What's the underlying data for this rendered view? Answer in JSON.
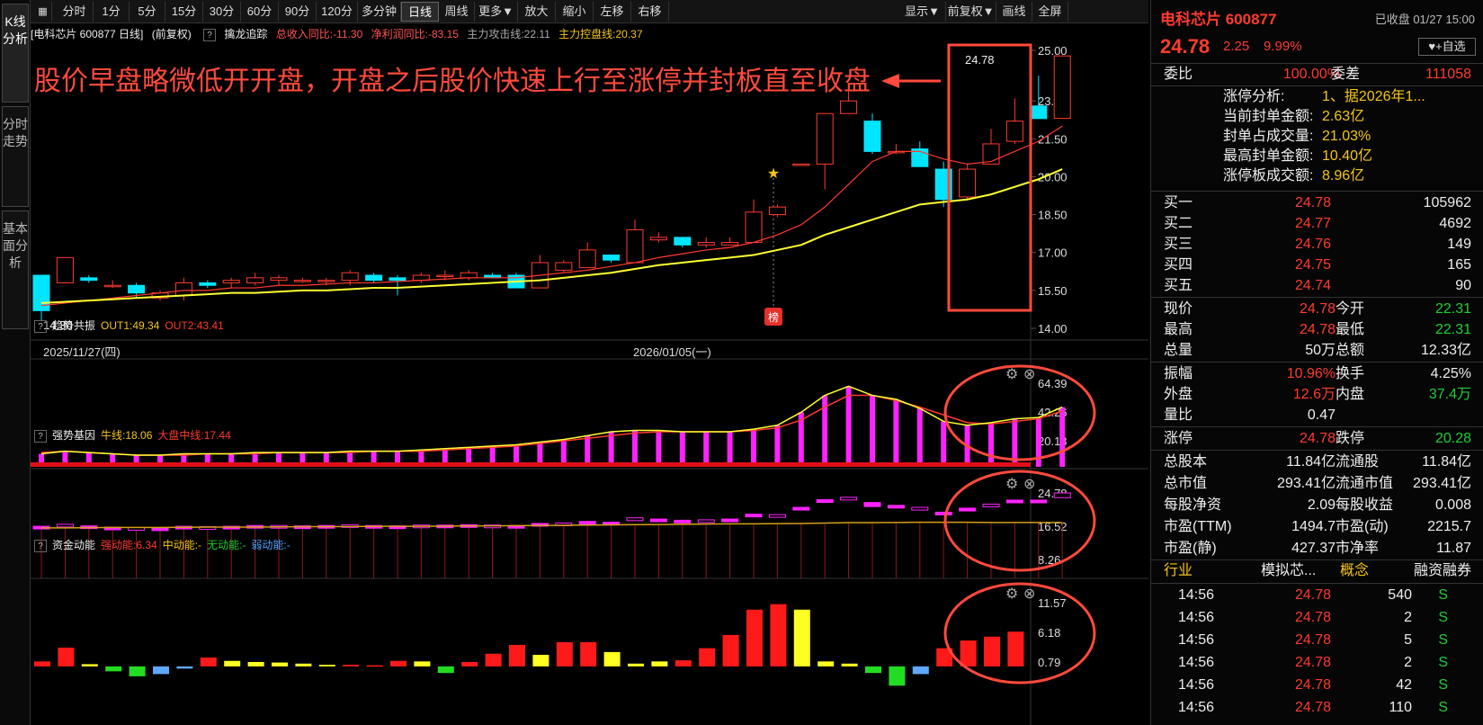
{
  "left_tabs": [
    "K线分析",
    "分时走势",
    "基本面分析"
  ],
  "toolbar": {
    "left": [
      "分时",
      "1分",
      "5分",
      "15分",
      "30分",
      "60分",
      "90分",
      "120分",
      "多分钟",
      "日线",
      "周线",
      "更多▼",
      "放大",
      "缩小",
      "左移",
      "右移"
    ],
    "active": "日线",
    "right": [
      "显示▼",
      "前复权▼",
      "画线",
      "全屏"
    ]
  },
  "info": {
    "title": "[电科芯片 600877 日线]",
    "fq": "(前复权)",
    "q": "?",
    "indicator": "擒龙追踪",
    "rev": "总收入同比:-11.30",
    "profit": "净利润同比:-83.15",
    "atk": "主力攻击线:22.11",
    "ctl": "主力控盘线:20.37"
  },
  "annotation": "股价早盘略微低开开盘，开盘之后股价快速上行至涨停并封板直至收盘",
  "labels": {
    "high": "24.78",
    "low": "14.30",
    "bang": "榜"
  },
  "date_labels": [
    "2025/11/27(四)",
    "2026/01/05(一)"
  ],
  "axis_main": [
    "25.00",
    "23.00",
    "21.50",
    "20.00",
    "18.50",
    "17.00",
    "15.50",
    "14.00"
  ],
  "panels": [
    {
      "name": "趋势共振",
      "vals": [
        "OUT1:49.34",
        "OUT2:43.41"
      ],
      "axis": [
        "64.39",
        "42.26",
        "20.13"
      ]
    },
    {
      "name": "强势基因",
      "vals": [
        "牛线:18.06",
        "大盘中线:17.44"
      ],
      "axis": [
        "24.78",
        "16.52",
        "8.26"
      ]
    },
    {
      "name": "资金动能",
      "vals": [
        "强动能:6.34",
        "中动能:-",
        "无动能:-",
        "弱动能:-"
      ],
      "axis": [
        "11.57",
        "6.18",
        "0.79"
      ]
    }
  ],
  "chart_data": {
    "type": "candlestick",
    "candles": [
      [
        16.1,
        14.7,
        16.1,
        14.3
      ],
      [
        15.8,
        16.8,
        16.8,
        15.8
      ],
      [
        16.0,
        15.9,
        16.1,
        15.8
      ],
      [
        15.7,
        15.7,
        15.9,
        15.6
      ],
      [
        15.7,
        15.4,
        15.8,
        15.2
      ],
      [
        15.2,
        15.4,
        15.5,
        15.1
      ],
      [
        15.3,
        15.8,
        16.0,
        15.1
      ],
      [
        15.8,
        15.7,
        15.9,
        15.6
      ],
      [
        15.8,
        15.9,
        16.0,
        15.6
      ],
      [
        15.8,
        16.0,
        16.2,
        15.7
      ],
      [
        15.9,
        16.0,
        16.1,
        15.7
      ],
      [
        15.9,
        15.9,
        16.0,
        15.8
      ],
      [
        15.9,
        15.9,
        16.0,
        15.7
      ],
      [
        15.9,
        16.2,
        16.3,
        15.7
      ],
      [
        16.1,
        15.9,
        16.2,
        15.8
      ],
      [
        16.0,
        15.9,
        16.1,
        15.3
      ],
      [
        15.9,
        16.1,
        16.2,
        15.8
      ],
      [
        16.1,
        16.1,
        16.3,
        15.9
      ],
      [
        16.0,
        16.2,
        16.3,
        15.9
      ],
      [
        16.1,
        16.0,
        16.2,
        16.0
      ],
      [
        16.1,
        15.6,
        16.2,
        15.6
      ],
      [
        15.6,
        16.6,
        16.9,
        15.6
      ],
      [
        16.3,
        16.6,
        16.7,
        16.2
      ],
      [
        16.4,
        17.1,
        17.4,
        16.4
      ],
      [
        16.9,
        16.7,
        16.9,
        16.6
      ],
      [
        16.6,
        17.9,
        18.3,
        16.6
      ],
      [
        17.5,
        17.6,
        17.8,
        17.4
      ],
      [
        17.6,
        17.3,
        17.6,
        17.2
      ],
      [
        17.3,
        17.4,
        17.6,
        17.2
      ],
      [
        17.3,
        17.4,
        17.6,
        17.3
      ],
      [
        17.4,
        18.6,
        19.1,
        17.4
      ],
      [
        18.5,
        18.8,
        18.9,
        18.4
      ],
      [
        20.5,
        20.5,
        20.5,
        20.5
      ],
      [
        20.5,
        22.5,
        22.5,
        19.5
      ],
      [
        22.5,
        23.0,
        23.5,
        22.5
      ],
      [
        22.2,
        21.0,
        22.5,
        20.9
      ],
      [
        21.0,
        21.0,
        21.3,
        20.9
      ],
      [
        21.1,
        20.4,
        21.4,
        20.4
      ],
      [
        20.3,
        19.1,
        20.6,
        18.8
      ],
      [
        19.2,
        20.3,
        20.5,
        19.1
      ],
      [
        20.5,
        21.3,
        21.9,
        20.5
      ],
      [
        21.4,
        22.2,
        23.1,
        21.3
      ],
      [
        22.8,
        22.3,
        24.0,
        22.3
      ],
      [
        22.31,
        24.78,
        24.78,
        22.31
      ]
    ],
    "ma_red": [
      14.9,
      15.0,
      15.1,
      15.2,
      15.3,
      15.4,
      15.5,
      15.5,
      15.6,
      15.6,
      15.7,
      15.7,
      15.75,
      15.8,
      15.8,
      15.85,
      15.9,
      15.95,
      16.0,
      16.0,
      16.0,
      16.1,
      16.2,
      16.3,
      16.45,
      16.6,
      16.8,
      16.95,
      17.1,
      17.2,
      17.4,
      17.7,
      18.1,
      18.8,
      19.7,
      20.6,
      21.0,
      21.0,
      20.7,
      20.5,
      20.6,
      21.0,
      21.4,
      22.0
    ],
    "ma_yellow": [
      15.0,
      15.05,
      15.1,
      15.15,
      15.2,
      15.25,
      15.3,
      15.35,
      15.4,
      15.4,
      15.45,
      15.5,
      15.5,
      15.55,
      15.6,
      15.6,
      15.65,
      15.7,
      15.75,
      15.8,
      15.85,
      15.9,
      16.0,
      16.1,
      16.2,
      16.35,
      16.5,
      16.6,
      16.7,
      16.8,
      16.9,
      17.1,
      17.3,
      17.7,
      18.0,
      18.3,
      18.6,
      18.9,
      19.0,
      19.1,
      19.3,
      19.6,
      19.9,
      20.3
    ],
    "trend_bars": [
      10,
      12,
      11,
      10,
      9,
      9,
      10,
      10,
      10,
      11,
      11,
      11,
      11,
      12,
      12,
      12,
      13,
      14,
      15,
      16,
      17,
      19,
      21,
      24,
      27,
      28,
      28,
      27,
      27,
      27,
      29,
      32,
      42,
      55,
      62,
      55,
      52,
      45,
      35,
      32,
      34,
      37,
      38,
      46
    ],
    "trend_ma": [
      11,
      12,
      11,
      10,
      9,
      9,
      9,
      10,
      10,
      10,
      11,
      11,
      11,
      11,
      12,
      12,
      12,
      13,
      14,
      15,
      16,
      18,
      20,
      22,
      24,
      26,
      27,
      27,
      27,
      27,
      28,
      30,
      36,
      46,
      55,
      55,
      51,
      46,
      40,
      34,
      33,
      35,
      37,
      43
    ],
    "gene_boxes": [
      [
        16.5,
        15.9
      ],
      [
        17.0,
        16.5
      ],
      [
        16.6,
        16.2
      ],
      [
        16.3,
        16.0
      ],
      [
        16.2,
        15.9
      ],
      [
        16.1,
        15.9
      ],
      [
        16.5,
        16.0
      ],
      [
        16.4,
        16.2
      ],
      [
        16.5,
        16.3
      ],
      [
        16.7,
        16.4
      ],
      [
        16.7,
        16.5
      ],
      [
        16.6,
        16.5
      ],
      [
        16.7,
        16.5
      ],
      [
        16.9,
        16.6
      ],
      [
        16.7,
        16.5
      ],
      [
        16.6,
        16.4
      ],
      [
        16.8,
        16.6
      ],
      [
        16.8,
        16.7
      ],
      [
        16.9,
        16.7
      ],
      [
        16.8,
        16.7
      ],
      [
        16.7,
        16.6
      ],
      [
        17.2,
        16.9
      ],
      [
        17.3,
        17.0
      ],
      [
        17.7,
        17.3
      ],
      [
        17.5,
        17.3
      ],
      [
        18.6,
        17.9
      ],
      [
        18.3,
        18.1
      ],
      [
        18.0,
        17.7
      ],
      [
        18.1,
        17.9
      ],
      [
        18.3,
        18.0
      ],
      [
        19.5,
        18.9
      ],
      [
        19.4,
        19.2
      ],
      [
        21.2,
        20.9
      ],
      [
        23.1,
        22.6
      ],
      [
        23.7,
        23.1
      ],
      [
        22.4,
        21.4
      ],
      [
        21.7,
        21.3
      ],
      [
        21.2,
        20.7
      ],
      [
        20.0,
        19.6
      ],
      [
        21.0,
        20.3
      ],
      [
        22.0,
        21.4
      ],
      [
        23.0,
        22.4
      ],
      [
        23.0,
        22.5
      ],
      [
        24.78,
        23.6
      ]
    ],
    "gene_line": [
      16.1,
      16.1,
      16.15,
      16.2,
      16.2,
      16.2,
      16.25,
      16.3,
      16.3,
      16.3,
      16.35,
      16.4,
      16.4,
      16.45,
      16.5,
      16.5,
      16.5,
      16.55,
      16.6,
      16.6,
      16.65,
      16.7,
      16.75,
      16.8,
      16.85,
      16.9,
      16.95,
      17.0,
      17.05,
      17.1,
      17.1,
      17.15,
      17.2,
      17.3,
      17.4,
      17.4,
      17.45,
      17.5,
      17.5,
      17.5,
      17.45,
      17.44,
      17.44,
      17.44
    ],
    "energy": [
      [
        0.9,
        "r"
      ],
      [
        3.4,
        "r"
      ],
      [
        0.4,
        "y"
      ],
      [
        -0.9,
        "g"
      ],
      [
        -1.8,
        "g"
      ],
      [
        -1.4,
        "b"
      ],
      [
        -0.4,
        "b"
      ],
      [
        1.6,
        "r"
      ],
      [
        1.0,
        "y"
      ],
      [
        0.8,
        "y"
      ],
      [
        0.7,
        "y"
      ],
      [
        0.5,
        "y"
      ],
      [
        0.3,
        "y"
      ],
      [
        0.3,
        "r"
      ],
      [
        0.2,
        "r"
      ],
      [
        1.0,
        "r"
      ],
      [
        0.9,
        "y"
      ],
      [
        -1.2,
        "g"
      ],
      [
        0.8,
        "r"
      ],
      [
        2.3,
        "r"
      ],
      [
        3.9,
        "r"
      ],
      [
        2.1,
        "y"
      ],
      [
        4.4,
        "r"
      ],
      [
        4.4,
        "r"
      ],
      [
        2.6,
        "y"
      ],
      [
        0.5,
        "y"
      ],
      [
        0.9,
        "y"
      ],
      [
        1.1,
        "r"
      ],
      [
        3.3,
        "r"
      ],
      [
        5.7,
        "r"
      ],
      [
        10.3,
        "r"
      ],
      [
        11.3,
        "r"
      ],
      [
        10.3,
        "y"
      ],
      [
        0.9,
        "y"
      ],
      [
        0.5,
        "y"
      ],
      [
        -1.2,
        "g"
      ],
      [
        -3.5,
        "g"
      ],
      [
        -1.4,
        "b"
      ],
      [
        3.3,
        "r"
      ],
      [
        4.7,
        "r"
      ],
      [
        5.4,
        "r"
      ],
      [
        6.3,
        "r"
      ]
    ]
  },
  "rp": {
    "name": "电科芯片 600877",
    "status": "已收盘 01/27 15:00",
    "price": "24.78",
    "chg": "2.25",
    "pct": "9.99%",
    "watch": "+自选",
    "weibi_l": "委比",
    "weibi": "100.00%",
    "weicha_l": "委差",
    "weicha": "111058",
    "zt": [
      [
        "涨停分析:",
        "1、据2026年1..."
      ],
      [
        "当前封单金额:",
        "2.63亿"
      ],
      [
        "封单占成交量:",
        "21.03%"
      ],
      [
        "最高封单金额:",
        "10.40亿"
      ],
      [
        "涨停板成交额:",
        "8.96亿"
      ]
    ],
    "book": [
      [
        "买一",
        "24.78",
        "105962"
      ],
      [
        "买二",
        "24.77",
        "4692"
      ],
      [
        "买三",
        "24.76",
        "149"
      ],
      [
        "买四",
        "24.75",
        "165"
      ],
      [
        "买五",
        "24.74",
        "90"
      ]
    ],
    "q1": [
      [
        "现价",
        "24.78",
        "今开",
        "22.31"
      ],
      [
        "最高",
        "24.78",
        "最低",
        "22.31"
      ],
      [
        "总量",
        "50万",
        "总额",
        "12.33亿"
      ]
    ],
    "q2": [
      [
        "振幅",
        "10.96%",
        "换手",
        "4.25%"
      ],
      [
        "外盘",
        "12.6万",
        "内盘",
        "37.4万"
      ],
      [
        "量比",
        "0.47",
        "",
        ""
      ]
    ],
    "q3": [
      [
        "涨停",
        "24.78",
        "跌停",
        "20.28"
      ]
    ],
    "q4": [
      [
        "总股本",
        "11.84亿",
        "流通股",
        "11.84亿"
      ],
      [
        "总市值",
        "293.41亿",
        "流通市值",
        "293.41亿"
      ],
      [
        "每股净资",
        "2.09",
        "每股收益",
        "0.008"
      ],
      [
        "市盈(TTM)",
        "1494.7",
        "市盈(动)",
        "2215.7"
      ],
      [
        "市盈(静)",
        "427.37",
        "市净率",
        "11.87"
      ]
    ],
    "industry": [
      "行业",
      "模拟芯...",
      "概念",
      "融资融券"
    ],
    "ticks": [
      [
        "14:56",
        "24.78",
        "540",
        "S"
      ],
      [
        "14:56",
        "24.78",
        "2",
        "S"
      ],
      [
        "14:56",
        "24.78",
        "5",
        "S"
      ],
      [
        "14:56",
        "24.78",
        "2",
        "S"
      ],
      [
        "14:56",
        "24.78",
        "42",
        "S"
      ],
      [
        "14:56",
        "24.78",
        "110",
        "S"
      ]
    ],
    "colors": {
      "up": "#ff3b30",
      "down": "#00e5ff",
      "ma1": "#ff3b30",
      "ma2": "#ffff33",
      "bar": "#ff22ff",
      "annot": "#ff4a3d"
    }
  }
}
